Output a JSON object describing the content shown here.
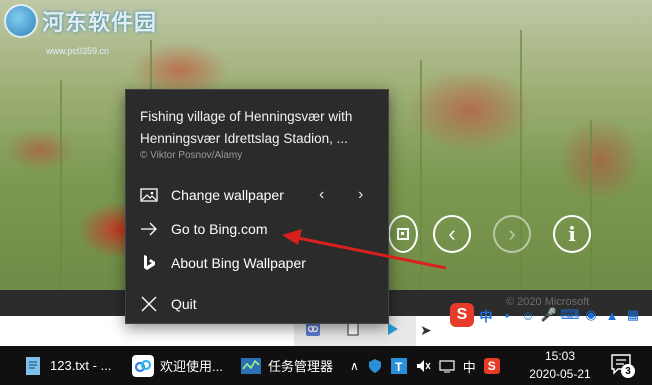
{
  "watermark": {
    "text": "河东软件园",
    "url": "www.pc0359.cn"
  },
  "menu": {
    "title": "Fishing village of Henningsvær with Henningsvær Idrettslag Stadion, ...",
    "credit": "© Viktor Posnov/Alamy",
    "items": [
      {
        "label": "Change wallpaper",
        "icon": "image-icon"
      },
      {
        "label": "Go to Bing.com",
        "icon": "arrow-right-icon"
      },
      {
        "label": "About Bing Wallpaper",
        "icon": "bing-logo-icon"
      },
      {
        "label": "Quit",
        "icon": "close-icon"
      }
    ]
  },
  "bing_bar": {
    "copyright": "© 2020 Microsoft"
  },
  "ime": {
    "logo": "S",
    "mode": "中"
  },
  "taskbar": {
    "apps": [
      {
        "label": "123.txt - ...",
        "icon": "notepad-icon"
      },
      {
        "label": "欢迎使用...",
        "icon": "baidu-netdisk-icon"
      },
      {
        "label": "任务管理器",
        "icon": "task-manager-icon"
      }
    ],
    "tray": {
      "ime_label": "中",
      "time": "15:03",
      "date": "2020-05-21",
      "notifications": "3"
    }
  },
  "colors": {
    "arrow": "#d8201c",
    "menu_bg": "#2b2b2b",
    "taskbar_bg": "#101010",
    "sogou": "#e73c2a"
  }
}
